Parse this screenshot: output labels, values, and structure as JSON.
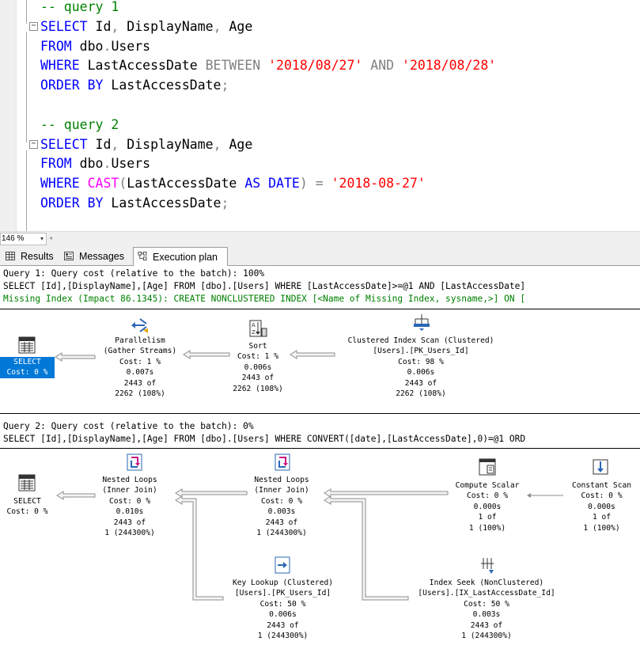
{
  "editor": {
    "lines": [
      [
        {
          "t": "-- query 1",
          "c": "cm"
        }
      ],
      [
        {
          "t": "SELECT",
          "c": "kw"
        },
        {
          "t": " Id",
          "c": "id"
        },
        {
          "t": ",",
          "c": "gy"
        },
        {
          "t": " DisplayName",
          "c": "id"
        },
        {
          "t": ",",
          "c": "gy"
        },
        {
          "t": " Age",
          "c": "id"
        }
      ],
      [
        {
          "t": "FROM",
          "c": "kw"
        },
        {
          "t": " dbo",
          "c": "id"
        },
        {
          "t": ".",
          "c": "gy"
        },
        {
          "t": "Users",
          "c": "id"
        }
      ],
      [
        {
          "t": "WHERE",
          "c": "kw"
        },
        {
          "t": " LastAccessDate ",
          "c": "id"
        },
        {
          "t": "BETWEEN",
          "c": "gy"
        },
        {
          "t": " ",
          "c": "id"
        },
        {
          "t": "'2018/08/27'",
          "c": "str"
        },
        {
          "t": " ",
          "c": "id"
        },
        {
          "t": "AND",
          "c": "gy"
        },
        {
          "t": " ",
          "c": "id"
        },
        {
          "t": "'2018/08/28'",
          "c": "str"
        }
      ],
      [
        {
          "t": "ORDER BY",
          "c": "kw"
        },
        {
          "t": " LastAccessDate",
          "c": "id"
        },
        {
          "t": ";",
          "c": "gy"
        }
      ],
      [],
      [
        {
          "t": "-- query 2",
          "c": "cm"
        }
      ],
      [
        {
          "t": "SELECT",
          "c": "kw"
        },
        {
          "t": " Id",
          "c": "id"
        },
        {
          "t": ",",
          "c": "gy"
        },
        {
          "t": " DisplayName",
          "c": "id"
        },
        {
          "t": ",",
          "c": "gy"
        },
        {
          "t": " Age",
          "c": "id"
        }
      ],
      [
        {
          "t": "FROM",
          "c": "kw"
        },
        {
          "t": " dbo",
          "c": "id"
        },
        {
          "t": ".",
          "c": "gy"
        },
        {
          "t": "Users",
          "c": "id"
        }
      ],
      [
        {
          "t": "WHERE",
          "c": "kw"
        },
        {
          "t": " ",
          "c": "id"
        },
        {
          "t": "CAST",
          "c": "fn"
        },
        {
          "t": "(",
          "c": "gy"
        },
        {
          "t": "LastAccessDate ",
          "c": "id"
        },
        {
          "t": "AS",
          "c": "kw"
        },
        {
          "t": " ",
          "c": "id"
        },
        {
          "t": "DATE",
          "c": "kw"
        },
        {
          "t": ")",
          "c": "gy"
        },
        {
          "t": " ",
          "c": "id"
        },
        {
          "t": "=",
          "c": "gy"
        },
        {
          "t": " ",
          "c": "id"
        },
        {
          "t": "'2018-08-27'",
          "c": "str"
        }
      ],
      [
        {
          "t": "ORDER BY",
          "c": "kw"
        },
        {
          "t": " LastAccessDate",
          "c": "id"
        },
        {
          "t": ";",
          "c": "gy"
        }
      ]
    ],
    "fold_glyph": "−"
  },
  "zoom": {
    "value": "146 %",
    "arrow": "▾",
    "scroll_arrow": "◂"
  },
  "tabs": [
    {
      "label": "Results",
      "icon": "grid-icon"
    },
    {
      "label": "Messages",
      "icon": "messages-icon"
    },
    {
      "label": "Execution plan",
      "icon": "plan-icon",
      "active": true
    }
  ],
  "query1": {
    "header": "Query 1: Query cost (relative to the batch): 100%",
    "sql": "SELECT [Id],[DisplayName],[Age] FROM [dbo].[Users] WHERE [LastAccessDate]>=@1 AND [LastAccessDate]",
    "missing_index": "Missing Index (Impact 86.1345): CREATE NONCLUSTERED INDEX [<Name of Missing Index, sysname,>] ON [",
    "nodes": [
      {
        "id": "q1-select",
        "icon": "select-icon",
        "lines": [
          "SELECT",
          "Cost: 0 %"
        ],
        "selected": true
      },
      {
        "id": "q1-parallelism",
        "icon": "parallelism-icon",
        "lines": [
          "Parallelism",
          "(Gather Streams)",
          "Cost: 1 %",
          "0.007s",
          "2443 of",
          "2262 (108%)"
        ]
      },
      {
        "id": "q1-sort",
        "icon": "sort-icon",
        "lines": [
          "Sort",
          "Cost: 1 %",
          "0.006s",
          "2443 of",
          "2262 (108%)"
        ]
      },
      {
        "id": "q1-scan",
        "icon": "clustered-index-scan-icon",
        "lines": [
          "Clustered Index Scan (Clustered)",
          "[Users].[PK_Users_Id]",
          "Cost: 98 %",
          "0.006s",
          "2443 of",
          "2262 (108%)"
        ]
      }
    ]
  },
  "query2": {
    "header": "Query 2: Query cost (relative to the batch): 0%",
    "sql": "SELECT [Id],[DisplayName],[Age] FROM [dbo].[Users] WHERE CONVERT([date],[LastAccessDate],0)=@1 ORD",
    "nodes": [
      {
        "id": "q2-select",
        "icon": "select-icon",
        "lines": [
          "SELECT",
          "Cost: 0 %"
        ]
      },
      {
        "id": "q2-loops1",
        "icon": "nested-loops-icon",
        "lines": [
          "Nested Loops",
          "(Inner Join)",
          "Cost: 0 %",
          "0.010s",
          "2443 of",
          "1 (244300%)"
        ]
      },
      {
        "id": "q2-loops2",
        "icon": "nested-loops-icon",
        "lines": [
          "Nested Loops",
          "(Inner Join)",
          "Cost: 0 %",
          "0.003s",
          "2443 of",
          "1 (244300%)"
        ]
      },
      {
        "id": "q2-compute",
        "icon": "compute-scalar-icon",
        "lines": [
          "Compute Scalar",
          "Cost: 0 %",
          "0.000s",
          "1 of",
          "1 (100%)"
        ]
      },
      {
        "id": "q2-constant",
        "icon": "constant-scan-icon",
        "lines": [
          "Constant Scan",
          "Cost: 0 %",
          "0.000s",
          "1 of",
          "1 (100%)"
        ]
      },
      {
        "id": "q2-keylookup",
        "icon": "key-lookup-icon",
        "lines": [
          "Key Lookup (Clustered)",
          "[Users].[PK_Users_Id]",
          "Cost: 50 %",
          "0.006s",
          "2443 of",
          "1 (244300%)"
        ]
      },
      {
        "id": "q2-seek",
        "icon": "index-seek-icon",
        "lines": [
          "Index Seek (NonClustered)",
          "[Users].[IX_LastAccessDate_Id]",
          "Cost: 50 %",
          "0.003s",
          "2443 of",
          "1 (244300%)"
        ]
      }
    ]
  }
}
